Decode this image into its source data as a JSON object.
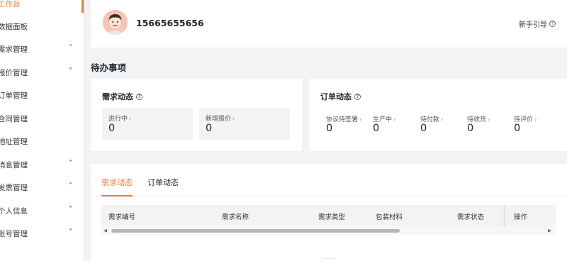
{
  "sidebar": {
    "items": [
      {
        "label": "工作台",
        "expandable": false,
        "active": true
      },
      {
        "label": "数据面板",
        "expandable": false
      },
      {
        "label": "需求管理",
        "expandable": true
      },
      {
        "label": "报价管理",
        "expandable": true
      },
      {
        "label": "订单管理",
        "expandable": false
      },
      {
        "label": "合同管理",
        "expandable": false
      },
      {
        "label": "地址管理",
        "expandable": false
      },
      {
        "label": "消息管理",
        "expandable": true
      },
      {
        "label": "发票管理",
        "expandable": true
      },
      {
        "label": "个人信息",
        "expandable": true
      },
      {
        "label": "账号管理",
        "expandable": true
      }
    ],
    "chevron": "˅"
  },
  "header": {
    "phone": "15665655656",
    "guide_label": "新手引导",
    "help_icon": "?"
  },
  "todo": {
    "title": "待办事项",
    "demand": {
      "title": "需求动态",
      "stats": [
        {
          "label": "进行中",
          "value": "0"
        },
        {
          "label": "新增报价",
          "value": "0"
        }
      ]
    },
    "order": {
      "title": "订单动态",
      "stats": [
        {
          "label": "协议待签署",
          "value": "0"
        },
        {
          "label": "生产中",
          "value": "0"
        },
        {
          "label": "待付款",
          "value": "0"
        },
        {
          "label": "待收货",
          "value": "0"
        },
        {
          "label": "待评价",
          "value": "0"
        }
      ]
    },
    "arrow": "›"
  },
  "panel": {
    "tabs": [
      {
        "label": "需求动态",
        "active": true
      },
      {
        "label": "订单动态",
        "active": false
      }
    ],
    "columns": [
      "需求编号",
      "需求名称",
      "需求类型",
      "包装材料",
      "需求状态",
      "操作"
    ]
  },
  "colors": {
    "accent": "#f07a3c",
    "background": "#f2f3f5"
  }
}
